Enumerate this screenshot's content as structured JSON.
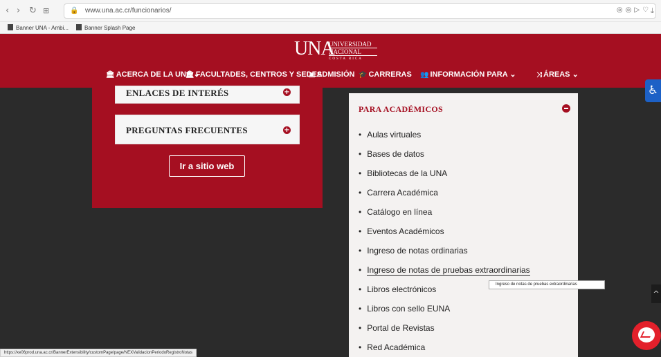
{
  "browser": {
    "url": "www.una.ac.cr/funcionarios/",
    "back_icon": "chevron-left-icon",
    "forward_icon": "chevron-right-icon",
    "reload_icon": "reload-icon",
    "bookmarks": [
      {
        "label": "Banner UNA - Ambi..."
      },
      {
        "label": "Banner Splash Page"
      }
    ],
    "status_url": "https://xe06prod.una.ac.cr/BannerExtensibility/customPage/page/NEXValidacionPeriodoRegistroNotas"
  },
  "site": {
    "brand_color": "#a50f21",
    "logo": {
      "main": "UNA",
      "line1": "UNIVERSIDAD",
      "line2": "NACIONAL",
      "line3": "COSTA RICA"
    },
    "nav": [
      {
        "label": "ACERCA DE LA UNA",
        "icon": "institution-icon",
        "has_caret": true
      },
      {
        "label": "FACULTADES, CENTROS Y SEDES",
        "icon": "institution-icon",
        "has_caret": false
      },
      {
        "label": "ADMISIÓN",
        "icon": "id-card-icon",
        "has_caret": false
      },
      {
        "label": "CARRERAS",
        "icon": "graduation-cap-icon",
        "has_caret": false
      },
      {
        "label": "INFORMACIÓN PARA",
        "icon": "users-icon",
        "has_caret": true
      },
      {
        "label": "ÁREAS",
        "icon": "shuffle-icon",
        "has_caret": true
      }
    ]
  },
  "left": {
    "cards": [
      {
        "title": "ENLACES DE INTERÉS"
      },
      {
        "title": "PREGUNTAS FRECUENTES"
      }
    ],
    "button_label": "Ir a sitio web"
  },
  "panel": {
    "title": "PARA ACADÉMICOS",
    "items": [
      "Aulas virtuales",
      "Bases de datos",
      "Bibliotecas de la UNA",
      "Carrera Académica",
      "Catálogo en línea",
      "Eventos Académicos",
      "Ingreso de notas ordinarias",
      "Ingreso de notas de pruebas extraordinarias",
      "Libros electrónicos",
      "Libros con sello EUNA",
      "Portal de Revistas",
      "Red Académica"
    ],
    "hovered_index": 7
  },
  "tooltip": "Ingreso de notas de pruebas extraordinarias"
}
